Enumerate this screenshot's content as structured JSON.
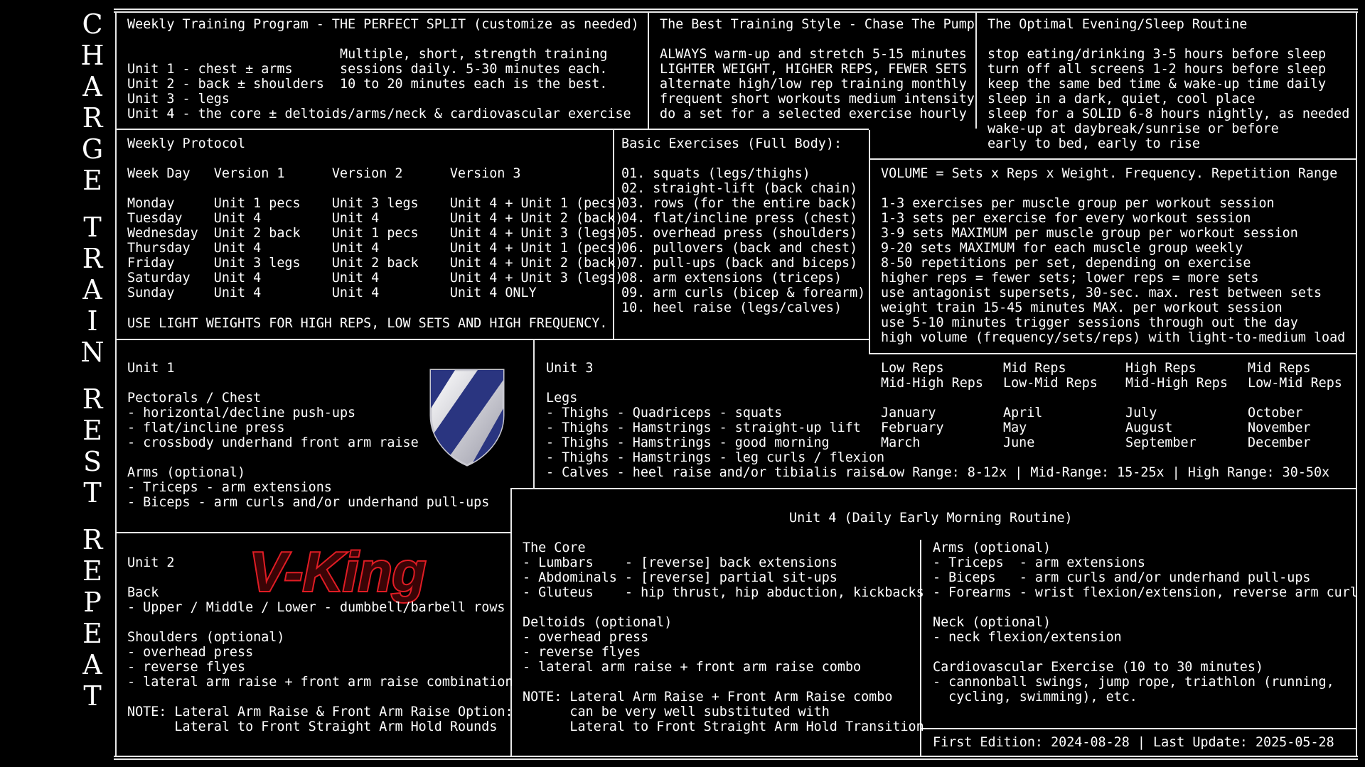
{
  "sidebar": {
    "groups": [
      {
        "word": "CHARGE",
        "letters": [
          "C",
          "H",
          "A",
          "R",
          "G",
          "E"
        ]
      },
      {
        "word": "TRAIN",
        "letters": [
          "T",
          "R",
          "A",
          "I",
          "N"
        ]
      },
      {
        "word": "REST",
        "letters": [
          "R",
          "E",
          "S",
          "T"
        ]
      },
      {
        "word": "REPEAT",
        "letters": [
          "R",
          "E",
          "P",
          "E",
          "A",
          "T"
        ]
      }
    ]
  },
  "weekly_program": {
    "title": "Weekly Training Program - THE PERFECT SPLIT (customize as needed)",
    "units": [
      "Unit 1 - chest ± arms",
      "Unit 2 - back ± shoulders",
      "Unit 3 - legs",
      "Unit 4 - the core ± deltoids/arms/neck & cardiovascular exercise"
    ],
    "note": [
      "Multiple, short, strength training",
      "sessions daily. 5-30 minutes each.",
      "10 to 20 minutes each is the best."
    ]
  },
  "training_style": {
    "title": "The Best Training Style - Chase The Pump",
    "lines": [
      "ALWAYS warm-up and stretch 5-15 minutes",
      "LIGHTER WEIGHT, HIGHER REPS, FEWER SETS",
      "alternate high/low rep training monthly",
      "frequent short workouts medium intensity",
      "do a set for a selected exercise hourly"
    ]
  },
  "evening_routine": {
    "title": "The Optimal Evening/Sleep Routine",
    "lines": [
      "stop eating/drinking 3-5 hours before sleep",
      "turn off all screens 1-2 hours before sleep",
      "keep the same bed time & wake-up time daily",
      "sleep in a dark, quiet, cool place",
      "sleep for a SOLID 6-8 hours nightly, as needed",
      "wake-up at daybreak/sunrise or before",
      "early to bed, early to rise"
    ]
  },
  "weekly_protocol": {
    "title": "Weekly Protocol",
    "headers": [
      "Week Day",
      "Version 1",
      "Version 2",
      "Version 3"
    ],
    "rows": [
      [
        "Monday",
        "Unit 1 pecs",
        "Unit 3 legs",
        "Unit 4 + Unit 1 (pecs)"
      ],
      [
        "Tuesday",
        "Unit 4",
        "Unit 4",
        "Unit 4 + Unit 2 (back)"
      ],
      [
        "Wednesday",
        "Unit 2 back",
        "Unit 1 pecs",
        "Unit 4 + Unit 3 (legs)"
      ],
      [
        "Thursday",
        "Unit 4",
        "Unit 4",
        "Unit 4 + Unit 1 (pecs)"
      ],
      [
        "Friday",
        "Unit 3 legs",
        "Unit 2 back",
        "Unit 4 + Unit 2 (back)"
      ],
      [
        "Saturday",
        "Unit 4",
        "Unit 4",
        "Unit 4 + Unit 3 (legs)"
      ],
      [
        "Sunday",
        "Unit 4",
        "Unit 4",
        "Unit 4 ONLY"
      ]
    ],
    "footer": "USE LIGHT WEIGHTS FOR HIGH REPS, LOW SETS AND HIGH FREQUENCY."
  },
  "basic_exercises": {
    "title": "Basic Exercises (Full Body):",
    "items": [
      "01. squats (legs/thighs)",
      "02. straight-lift (back chain)",
      "03. rows (for the entire back)",
      "04. flat/incline press (chest)",
      "05. overhead press (shoulders)",
      "06. pullovers (back and chest)",
      "07. pull-ups (back and biceps)",
      "08. arm extensions (triceps)",
      "09. arm curls (bicep & forearm)",
      "10. heel raise (legs/calves)"
    ]
  },
  "volume": {
    "title": "VOLUME = Sets x Reps x Weight. Frequency. Repetition Range",
    "lines": [
      "1-3 exercises per muscle group per workout session",
      "1-3 sets per exercise for every workout session",
      "3-9 sets MAXIMUM per muscle group per workout session",
      "9-20 sets MAXIMUM for each muscle group weekly",
      "8-50 repetitions per set, depending on exercise",
      "higher reps = fewer sets; lower reps = more sets",
      "use antagonist supersets, 30-sec. max. rest between sets",
      "weight train 15-45 minutes MAX. per workout session",
      "use 5-10 minutes trigger sessions through out the day",
      "high volume (frequency/sets/reps) with light-to-medium load"
    ]
  },
  "unit1": {
    "title": "Unit 1",
    "section1_title": "Pectorals / Chest",
    "section1_items": [
      "- horizontal/decline push-ups",
      "- flat/incline press",
      "- crossbody underhand front arm raise"
    ],
    "section2_title": "Arms (optional)",
    "section2_items": [
      "- Triceps - arm extensions",
      "- Biceps - arm curls and/or underhand pull-ups"
    ]
  },
  "unit3": {
    "title": "Unit 3",
    "section_title": "Legs",
    "items": [
      "- Thighs - Quadriceps - squats",
      "- Thighs - Hamstrings - straight-up lift",
      "- Thighs - Hamstrings - good morning",
      "- Thighs - Hamstrings - leg curls / flexion",
      "- Calves - heel raise and/or tibialis raise"
    ]
  },
  "rep_cycle": {
    "headers": [
      [
        "Low Reps",
        "Mid-High Reps"
      ],
      [
        "Mid Reps",
        "Low-Mid Reps"
      ],
      [
        "High Reps",
        "Mid-High Reps"
      ],
      [
        "Mid Reps",
        "Low-Mid Reps"
      ]
    ],
    "months": [
      [
        "January",
        "February",
        "March"
      ],
      [
        "April",
        "May",
        "June"
      ],
      [
        "July",
        "August",
        "September"
      ],
      [
        "October",
        "November",
        "December"
      ]
    ],
    "ranges": "Low Range: 8-12x | Mid-Range: 15-25x | High Range: 30-50x"
  },
  "unit2": {
    "title": "Unit 2",
    "logo_text": "V-King",
    "section1_title": "Back",
    "section1_items": [
      "- Upper / Middle / Lower - dumbbell/barbell rows"
    ],
    "section2_title": "Shoulders (optional)",
    "section2_items": [
      "- overhead press",
      "- reverse flyes",
      "- lateral arm raise + front arm raise combination"
    ],
    "note_line1": "NOTE: Lateral Arm Raise & Front Arm Raise Option:",
    "note_line2": "      Lateral to Front Straight Arm Hold Rounds"
  },
  "unit4": {
    "title": "Unit 4 (Daily Early Morning Routine)",
    "core_title": "The Core",
    "core_items": [
      "- Lumbars    - [reverse] back extensions",
      "- Abdominals - [reverse] partial sit-ups",
      "- Gluteus    - hip thrust, hip abduction, kickbacks"
    ],
    "deltoids_title": "Deltoids (optional)",
    "deltoids_items": [
      "- overhead press",
      "- reverse flyes",
      "- lateral arm raise + front arm raise combo"
    ],
    "note_lines": [
      "NOTE: Lateral Arm Raise + Front Arm Raise combo",
      "      can be very well substituted with",
      "      Lateral to Front Straight Arm Hold Transition"
    ],
    "arms_title": "Arms (optional)",
    "arms_items": [
      "- Triceps  - arm extensions",
      "- Biceps   - arm curls and/or underhand pull-ups",
      "- Forearms - wrist flexion/extension, reverse arm curl"
    ],
    "neck_title": "Neck (optional)",
    "neck_items": [
      "- neck flexion/extension"
    ],
    "cardio_title": "Cardiovascular Exercise (10 to 30 minutes)",
    "cardio_items": [
      "- cannonball swings, jump rope, triathlon (running,",
      "  cycling, swimming), etc."
    ]
  },
  "edition": "First Edition: 2024-08-28 | Last Update: 2025-05-28",
  "colors": {
    "background": "#000000",
    "text": "#ffffff",
    "shield_blue": "#2a3580",
    "logo_red": "#c0141c"
  }
}
